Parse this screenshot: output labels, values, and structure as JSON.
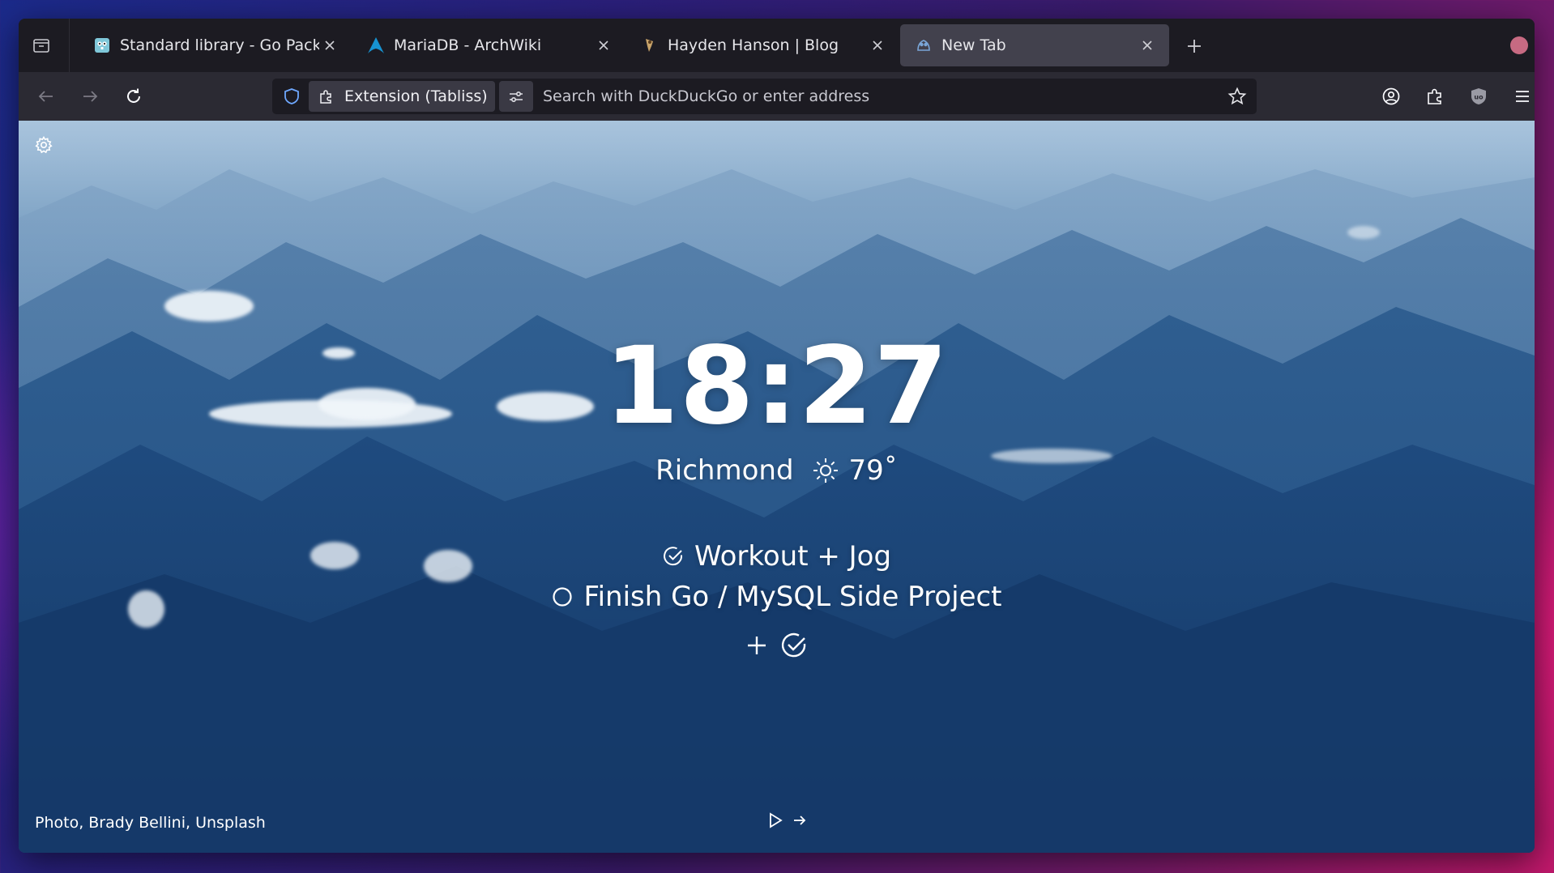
{
  "tabs": [
    {
      "title": "Standard library - Go Packag",
      "active": false,
      "favicon": "go-gopher-icon"
    },
    {
      "title": "MariaDB - ArchWiki",
      "active": false,
      "favicon": "arch-linux-icon"
    },
    {
      "title": "Hayden Hanson | Blog",
      "active": false,
      "favicon": "blog-logo-icon"
    },
    {
      "title": "New Tab",
      "active": true,
      "favicon": "tabliss-icon"
    }
  ],
  "urlbar": {
    "identity_label": "Extension (Tabliss)",
    "placeholder": "Search with DuckDuckGo or enter address"
  },
  "clock": {
    "time": "18:27"
  },
  "weather": {
    "location": "Richmond",
    "temperature": "79˚",
    "condition_icon": "sun-icon"
  },
  "todos": [
    {
      "text": "Workout + Jog",
      "done": true
    },
    {
      "text": "Finish Go / MySQL Side Project",
      "done": false
    }
  ],
  "background": {
    "credit": "Photo, Brady Bellini, Unsplash"
  },
  "colors": {
    "tab_active": "#42414d",
    "toolbar": "#2b2a33",
    "urlbar": "#1c1b22",
    "shield": "#6fa8ff"
  }
}
